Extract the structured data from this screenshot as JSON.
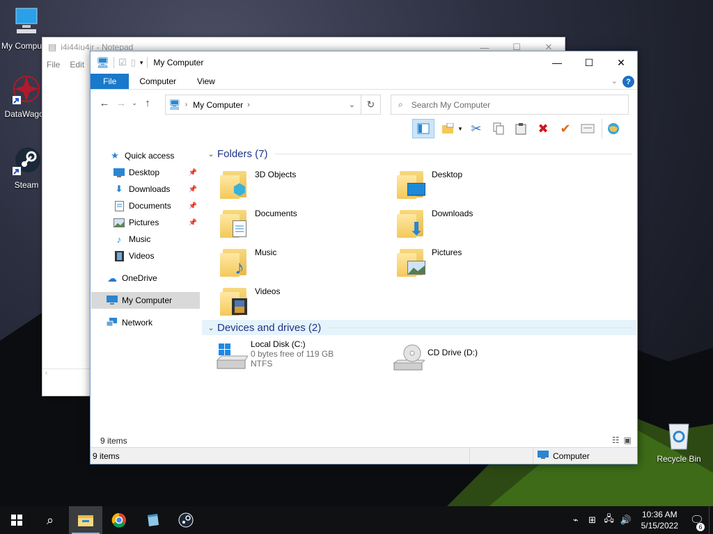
{
  "desktop": {
    "icons": [
      {
        "label": "My Computer"
      },
      {
        "label": "DataWagon"
      },
      {
        "label": "Steam"
      },
      {
        "label": "Recycle Bin"
      }
    ]
  },
  "notepad": {
    "title": "i4i44iu4jr - Notepad",
    "menu": [
      "File",
      "Edit"
    ]
  },
  "explorer": {
    "title": "My Computer",
    "tabs": [
      "File",
      "Computer",
      "View"
    ],
    "help": "?",
    "address": "My Computer",
    "search_placeholder": "Search My Computer",
    "folders_header": "Folders (7)",
    "folders": [
      {
        "name": "3D Objects"
      },
      {
        "name": "Desktop"
      },
      {
        "name": "Documents"
      },
      {
        "name": "Downloads"
      },
      {
        "name": "Music"
      },
      {
        "name": "Pictures"
      },
      {
        "name": "Videos"
      }
    ],
    "devices_header": "Devices and drives (2)",
    "drives": [
      {
        "name": "Local Disk (C:)",
        "free": "0 bytes free of 119 GB",
        "fs": "NTFS"
      },
      {
        "name": "CD Drive (D:)"
      }
    ],
    "nav": {
      "quick_access": "Quick access",
      "items": [
        "Desktop",
        "Downloads",
        "Documents",
        "Pictures",
        "Music",
        "Videos"
      ],
      "onedrive": "OneDrive",
      "mycomputer": "My Computer",
      "network": "Network"
    },
    "item_count": "9 items",
    "status_left": "9 items",
    "status_right": "Computer"
  },
  "taskbar": {
    "time": "10:36 AM",
    "date": "5/15/2022",
    "notifications": "6"
  },
  "colors": {
    "accent": "#1979ca",
    "group_header": "#1e3287"
  }
}
